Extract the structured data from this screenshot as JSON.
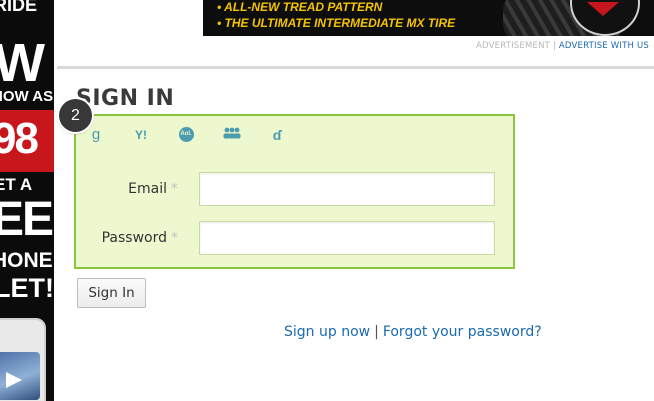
{
  "side_ad": {
    "line1": "RIDE",
    "line2": "W",
    "line3": "NOW AS",
    "line4": "98",
    "line5": "ET A",
    "line6": "EE",
    "line7": "HONE",
    "line8": "LET!"
  },
  "top_ad": {
    "bullet1": "• ALL-NEW TREAD PATTERN",
    "bullet2": "• THE ULTIMATE INTERMEDIATE MX TIRE"
  },
  "ad_caption": {
    "label": "ADVERTISEMENT",
    "separator": "|",
    "link": "ADVERTISE WITH US"
  },
  "page": {
    "title": "SIGN IN",
    "step_badge": "2"
  },
  "providers": {
    "google": "g",
    "yahoo": "Y!",
    "aol": "Aol.",
    "groups": "●●●",
    "openid": "ɗ"
  },
  "form": {
    "email_label": "Email",
    "email_required": "*",
    "email_value": "",
    "password_label": "Password",
    "password_required": "*",
    "password_value": "",
    "submit_label": "Sign In"
  },
  "footer_links": {
    "signup": "Sign up now",
    "separator": "|",
    "forgot": "Forgot your password?"
  },
  "colors": {
    "accent_green": "#8cc63f",
    "form_background": "#eef8cf",
    "link_blue": "#1a6ab0",
    "provider_icon": "#4a9cae"
  }
}
